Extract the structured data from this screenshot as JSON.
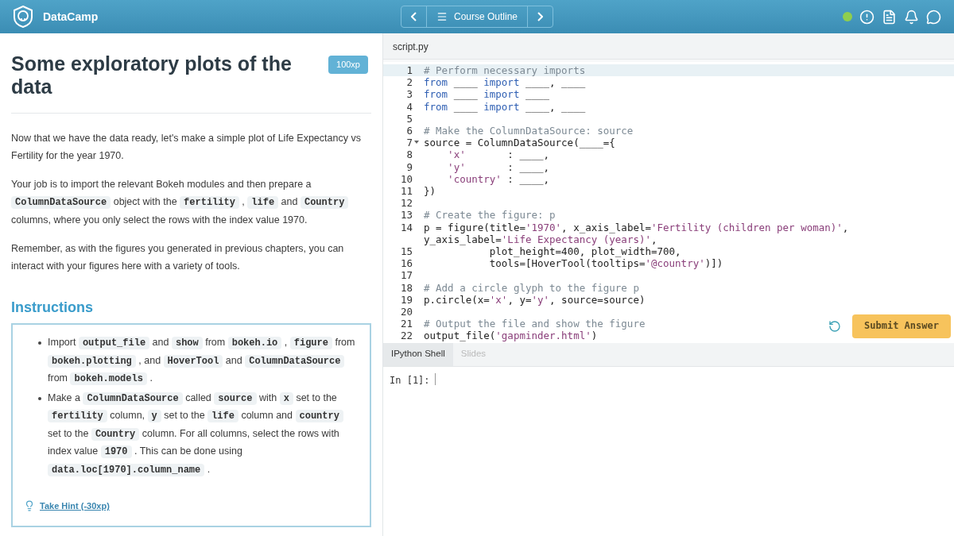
{
  "header": {
    "brand": "DataCamp",
    "nav_label": "Course Outline"
  },
  "exercise": {
    "title": "Some exploratory plots of the data",
    "xp": "100xp",
    "paragraphs": [
      [
        {
          "kind": "text",
          "text": "Now that we have the data ready, let's make a simple plot of Life Expectancy vs Fertility for the year 1970."
        }
      ],
      [
        {
          "kind": "text",
          "text": "Your job is to import the relevant Bokeh modules and then prepare a "
        },
        {
          "kind": "code",
          "text": "ColumnDataSource"
        },
        {
          "kind": "text",
          "text": " object with the "
        },
        {
          "kind": "code",
          "text": "fertility"
        },
        {
          "kind": "text",
          "text": " , "
        },
        {
          "kind": "code",
          "text": "life"
        },
        {
          "kind": "text",
          "text": " and "
        },
        {
          "kind": "code",
          "text": "Country"
        },
        {
          "kind": "text",
          "text": " columns, where you only select the rows with the index value 1970."
        }
      ],
      [
        {
          "kind": "text",
          "text": "Remember, as with the figures you generated in previous chapters, you can interact with your figures here with a variety of tools."
        }
      ]
    ]
  },
  "instructions": {
    "heading": "Instructions",
    "items": [
      [
        {
          "kind": "text",
          "text": "Import "
        },
        {
          "kind": "code",
          "text": "output_file"
        },
        {
          "kind": "text",
          "text": " and "
        },
        {
          "kind": "code",
          "text": "show"
        },
        {
          "kind": "text",
          "text": " from "
        },
        {
          "kind": "code",
          "text": "bokeh.io"
        },
        {
          "kind": "text",
          "text": " , "
        },
        {
          "kind": "code",
          "text": "figure"
        },
        {
          "kind": "text",
          "text": " from "
        },
        {
          "kind": "code",
          "text": "bokeh.plotting"
        },
        {
          "kind": "text",
          "text": " , and "
        },
        {
          "kind": "code",
          "text": "HoverTool"
        },
        {
          "kind": "text",
          "text": " and "
        },
        {
          "kind": "code",
          "text": "ColumnDataSource"
        },
        {
          "kind": "text",
          "text": " from "
        },
        {
          "kind": "code",
          "text": "bokeh.models"
        },
        {
          "kind": "text",
          "text": " ."
        }
      ],
      [
        {
          "kind": "text",
          "text": "Make a "
        },
        {
          "kind": "code",
          "text": "ColumnDataSource"
        },
        {
          "kind": "text",
          "text": " called "
        },
        {
          "kind": "code",
          "text": "source"
        },
        {
          "kind": "text",
          "text": " with "
        },
        {
          "kind": "code",
          "text": "x"
        },
        {
          "kind": "text",
          "text": " set to the "
        },
        {
          "kind": "code",
          "text": "fertility"
        },
        {
          "kind": "text",
          "text": " column, "
        },
        {
          "kind": "code",
          "text": "y"
        },
        {
          "kind": "text",
          "text": " set to the "
        },
        {
          "kind": "code",
          "text": "life"
        },
        {
          "kind": "text",
          "text": " column and "
        },
        {
          "kind": "code",
          "text": "country"
        },
        {
          "kind": "text",
          "text": " set to the "
        },
        {
          "kind": "code",
          "text": "Country"
        },
        {
          "kind": "text",
          "text": " column. For all columns, select the rows with index value "
        },
        {
          "kind": "code",
          "text": "1970"
        },
        {
          "kind": "text",
          "text": " . This can be done using "
        },
        {
          "kind": "code",
          "text": "data.loc[1970].column_name"
        },
        {
          "kind": "text",
          "text": " ."
        }
      ]
    ],
    "hint": "Take Hint (-30xp)"
  },
  "editor": {
    "tabs": [
      {
        "label": "script.py",
        "selected": true
      }
    ],
    "submit": "Submit Answer",
    "lines": [
      {
        "number": "1",
        "active": true,
        "fold": false,
        "tokens": [
          {
            "kind": "comment",
            "text": "# Perform necessary imports"
          }
        ]
      },
      {
        "number": "2",
        "active": false,
        "fold": false,
        "tokens": [
          {
            "kind": "keyword",
            "text": "from"
          },
          {
            "kind": "plain",
            "text": " ____ "
          },
          {
            "kind": "keyword",
            "text": "import"
          },
          {
            "kind": "plain",
            "text": " ____, ____"
          }
        ]
      },
      {
        "number": "3",
        "active": false,
        "fold": false,
        "tokens": [
          {
            "kind": "keyword",
            "text": "from"
          },
          {
            "kind": "plain",
            "text": " ____ "
          },
          {
            "kind": "keyword",
            "text": "import"
          },
          {
            "kind": "plain",
            "text": " ____"
          }
        ]
      },
      {
        "number": "4",
        "active": false,
        "fold": false,
        "tokens": [
          {
            "kind": "keyword",
            "text": "from"
          },
          {
            "kind": "plain",
            "text": " ____ "
          },
          {
            "kind": "keyword",
            "text": "import"
          },
          {
            "kind": "plain",
            "text": " ____, ____"
          }
        ]
      },
      {
        "number": "5",
        "active": false,
        "fold": false
      },
      {
        "number": "6",
        "active": false,
        "fold": false,
        "tokens": [
          {
            "kind": "comment",
            "text": "# Make the ColumnDataSource: source"
          }
        ]
      },
      {
        "number": "7",
        "active": false,
        "fold": true,
        "tokens": [
          {
            "kind": "plain",
            "text": "source = ColumnDataSource(____={"
          }
        ]
      },
      {
        "number": "8",
        "active": false,
        "fold": false,
        "tokens": [
          {
            "kind": "string",
            "text": "    'x'"
          },
          {
            "kind": "plain",
            "text": "       : ____,"
          }
        ]
      },
      {
        "number": "9",
        "active": false,
        "fold": false,
        "tokens": [
          {
            "kind": "string",
            "text": "    'y'"
          },
          {
            "kind": "plain",
            "text": "       : ____,"
          }
        ]
      },
      {
        "number": "10",
        "active": false,
        "fold": false,
        "tokens": [
          {
            "kind": "string",
            "text": "    'country'"
          },
          {
            "kind": "plain",
            "text": " : ____,"
          }
        ]
      },
      {
        "number": "11",
        "active": false,
        "fold": false,
        "tokens": [
          {
            "kind": "plain",
            "text": "})"
          }
        ]
      },
      {
        "number": "12",
        "active": false,
        "fold": false
      },
      {
        "number": "13",
        "active": false,
        "fold": false,
        "tokens": [
          {
            "kind": "comment",
            "text": "# Create the figure: p"
          }
        ]
      },
      {
        "number": "14",
        "active": false,
        "fold": false,
        "tokens": [
          {
            "kind": "plain",
            "text": "p = figure(title="
          },
          {
            "kind": "string",
            "text": "'1970'"
          },
          {
            "kind": "plain",
            "text": ", x_axis_label="
          },
          {
            "kind": "string",
            "text": "'Fertility (children per woman)'"
          },
          {
            "kind": "plain",
            "text": ", y_axis_label="
          },
          {
            "kind": "string",
            "text": "'Life Expectancy (years)'"
          },
          {
            "kind": "plain",
            "text": ","
          }
        ]
      },
      {
        "number": "15",
        "active": false,
        "fold": false,
        "tokens": [
          {
            "kind": "plain",
            "text": "           plot_height=400, plot_width=700,"
          }
        ]
      },
      {
        "number": "16",
        "active": false,
        "fold": false,
        "tokens": [
          {
            "kind": "plain",
            "text": "           tools=[HoverTool(tooltips="
          },
          {
            "kind": "string",
            "text": "'@country'"
          },
          {
            "kind": "plain",
            "text": ")])"
          }
        ]
      },
      {
        "number": "17",
        "active": false,
        "fold": false
      },
      {
        "number": "18",
        "active": false,
        "fold": false,
        "tokens": [
          {
            "kind": "comment",
            "text": "# Add a circle glyph to the figure p"
          }
        ]
      },
      {
        "number": "19",
        "active": false,
        "fold": false,
        "tokens": [
          {
            "kind": "plain",
            "text": "p.circle(x="
          },
          {
            "kind": "string",
            "text": "'x'"
          },
          {
            "kind": "plain",
            "text": ", y="
          },
          {
            "kind": "string",
            "text": "'y'"
          },
          {
            "kind": "plain",
            "text": ", source=source)"
          }
        ]
      },
      {
        "number": "20",
        "active": false,
        "fold": false
      },
      {
        "number": "21",
        "active": false,
        "fold": false,
        "tokens": [
          {
            "kind": "comment",
            "text": "# Output the file and show the figure"
          }
        ]
      },
      {
        "number": "22",
        "active": false,
        "fold": false,
        "tokens": [
          {
            "kind": "plain",
            "text": "output_file("
          },
          {
            "kind": "string",
            "text": "'gapminder.html'"
          },
          {
            "kind": "plain",
            "text": ")"
          }
        ]
      }
    ]
  },
  "shell": {
    "tabs": [
      {
        "label": "IPython Shell",
        "selected": true
      },
      {
        "label": "Slides",
        "selected": false
      }
    ],
    "prompt": "In [1]:"
  }
}
